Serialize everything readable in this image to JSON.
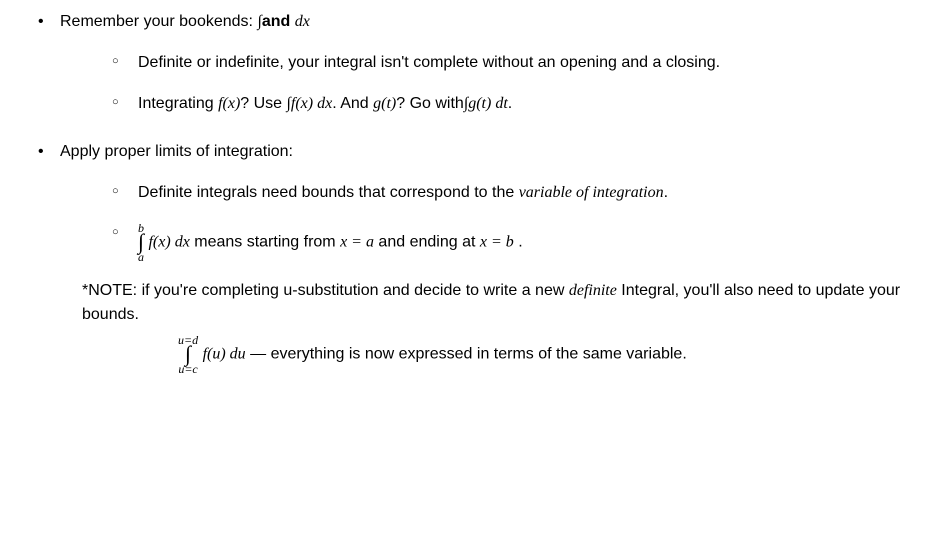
{
  "items": [
    {
      "title_pre": "Remember your bookends: ",
      "title_math1": "∫",
      "title_bold": "and ",
      "title_math2": "dx",
      "sub": [
        {
          "text": "Definite or indefinite, your integral isn't complete without an opening and a closing."
        },
        {
          "t1": "Integrating ",
          "m1": "f(x)",
          "t2": "? Use ",
          "m2": "∫f(x) dx",
          "t3": ". And ",
          "m3": "g(t)",
          "t4": "? Go with",
          "m4": "∫g(t) dt",
          "t5": "."
        }
      ]
    },
    {
      "title": "Apply proper limits of integration:",
      "sub": [
        {
          "t1": "Definite integrals need bounds that correspond to the ",
          "it1": "variable of integration",
          "t2": "."
        },
        {
          "int_up": "b",
          "int_lo": "a",
          "m1": "f(x) dx",
          "t1": " means starting from ",
          "m2": "x = a",
          "t2": " and ending at ",
          "m3": "x = b",
          "t3": " ."
        }
      ],
      "note": {
        "t1": "*NOTE: if you're completing u-substitution and decide to write a new ",
        "it1": "definite",
        "t2": " Integral, you'll also need to update your bounds.",
        "eq_up": "u=d",
        "eq_lo": "u=c",
        "eq_m1": "f(u) du",
        "eq_dash": " — ",
        "eq_t1": "everything is now expressed in terms of the same variable."
      }
    }
  ]
}
